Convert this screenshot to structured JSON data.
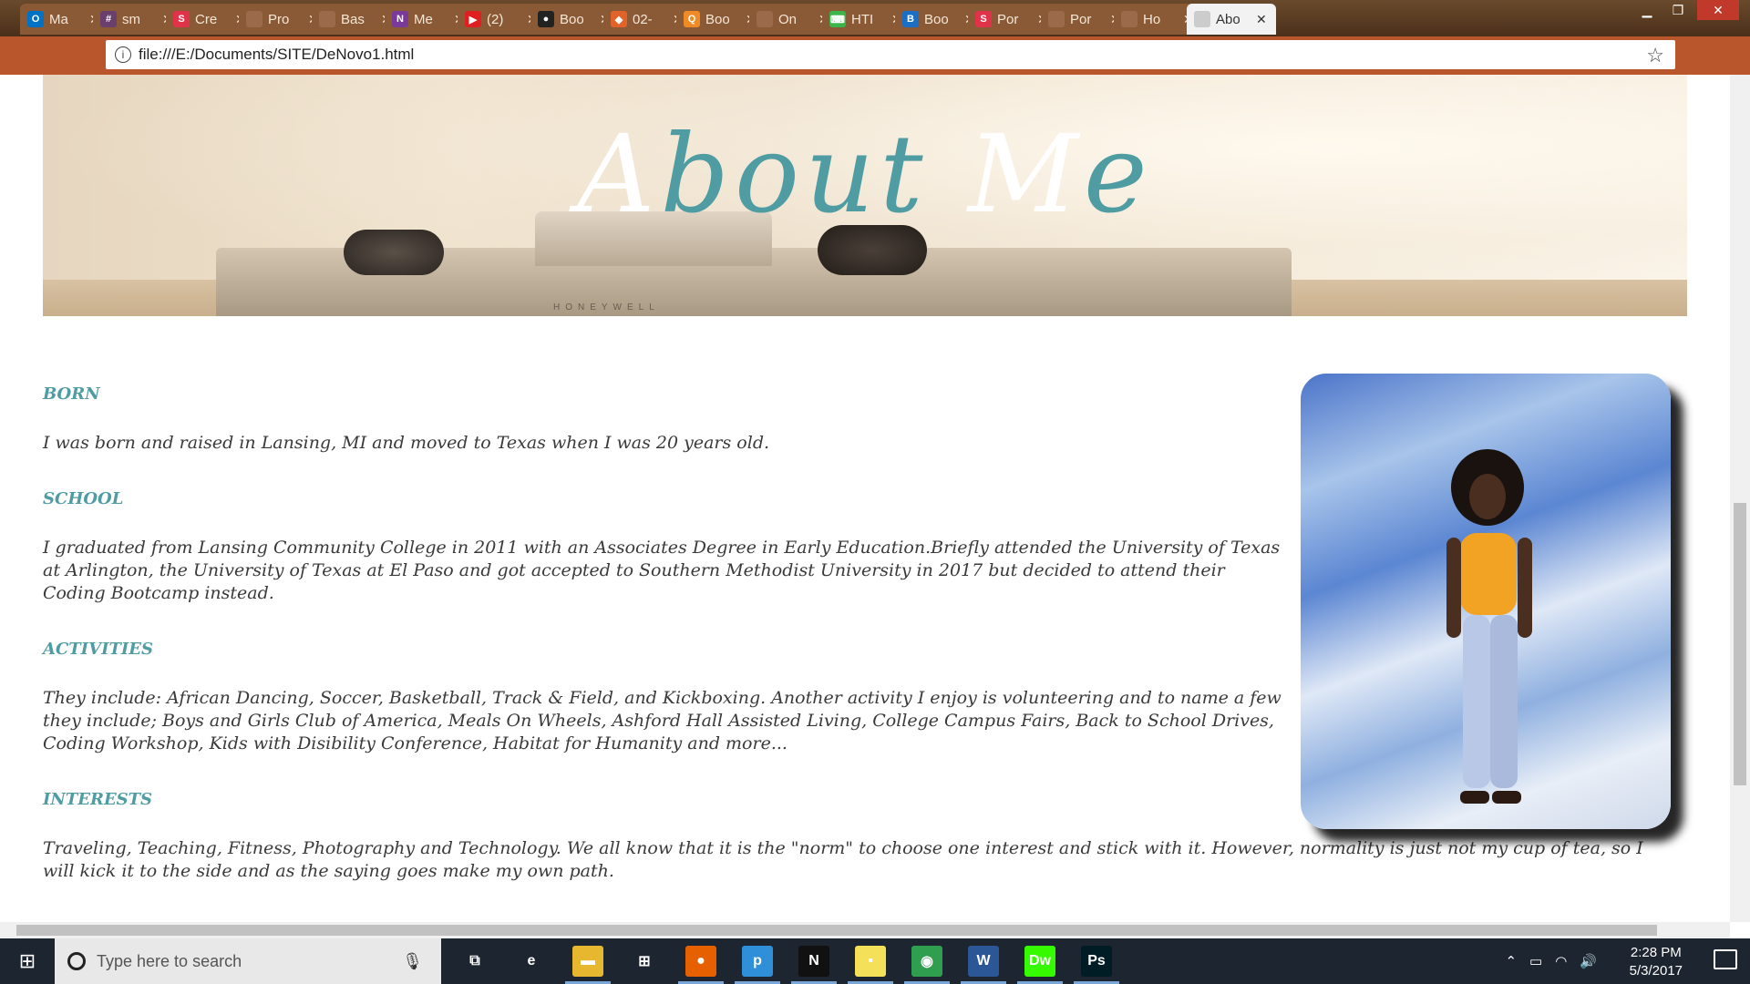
{
  "browser": {
    "tabs": [
      {
        "label": "Ma",
        "fav_text": "O",
        "fav_color": "#0072c6"
      },
      {
        "label": "sm",
        "fav_text": "#",
        "fav_color": "#6a3f6d"
      },
      {
        "label": "Cre",
        "fav_text": "S",
        "fav_color": "#e0334a"
      },
      {
        "label": "Pro",
        "fav_text": "",
        "fav_color": "#9a6a4a"
      },
      {
        "label": "Bas",
        "fav_text": "",
        "fav_color": "#9a6a4a"
      },
      {
        "label": "Me",
        "fav_text": "N",
        "fav_color": "#7a3a9a"
      },
      {
        "label": "(2)",
        "fav_text": "▶",
        "fav_color": "#e02020"
      },
      {
        "label": "Boo",
        "fav_text": "●",
        "fav_color": "#222222"
      },
      {
        "label": "02-",
        "fav_text": "◆",
        "fav_color": "#e2632a"
      },
      {
        "label": "Boo",
        "fav_text": "Q",
        "fav_color": "#f08a24"
      },
      {
        "label": "On",
        "fav_text": "",
        "fav_color": "#9a6a4a"
      },
      {
        "label": "HTI",
        "fav_text": "⌨",
        "fav_color": "#39b54a"
      },
      {
        "label": "Boo",
        "fav_text": "B",
        "fav_color": "#1a6fc4"
      },
      {
        "label": "Por",
        "fav_text": "S",
        "fav_color": "#e0334a"
      },
      {
        "label": "Por",
        "fav_text": "",
        "fav_color": "#9a6a4a"
      },
      {
        "label": "Ho",
        "fav_text": "",
        "fav_color": "#9a6a4a"
      },
      {
        "label": "Abo",
        "fav_text": "",
        "fav_color": "#cccccc"
      }
    ],
    "active_tab_index": 16,
    "url": "file:///E:/Documents/SITE/DeNovo1.html"
  },
  "page": {
    "hero_title_first": "A",
    "hero_title_accent": "bout",
    "hero_title_second": " M",
    "hero_title_accent2": "e",
    "camera_brand": "HONEYWELL",
    "sections": [
      {
        "heading": "BORN",
        "body": "I was born and raised in Lansing, MI and moved to Texas when I was 20 years old."
      },
      {
        "heading": "SCHOOL",
        "body": "I graduated from Lansing Community College in 2011 with an Associates Degree in Early Education.Briefly attended the University of Texas at Arlington, the University of Texas at El Paso and got accepted to Southern Methodist University in 2017 but decided to attend their Coding Bootcamp instead."
      },
      {
        "heading": "ACTIVITIES",
        "body": "They include: African Dancing, Soccer, Basketball, Track & Field, and Kickboxing. Another activity I enjoy is volunteering and to name a few they include; Boys and Girls Club of America, Meals On Wheels, Ashford Hall Assisted Living, College Campus Fairs, Back to School Drives, Coding Workshop, Kids with Disibility Conference, Habitat for Humanity and more..."
      },
      {
        "heading": "INTERESTS",
        "body": "Traveling, Teaching, Fitness, Photography and Technology. We all know that it is the \"norm\" to choose one interest and stick with it. However, normality is just not my cup of tea, so I will kick it to the side and as the saying goes make my own path."
      }
    ],
    "accent_color": "#4f9ca3"
  },
  "taskbar": {
    "search_placeholder": "Type here to search",
    "apps": [
      {
        "name": "task-view-icon",
        "label": "⧉",
        "color": "#1c2530"
      },
      {
        "name": "edge-icon",
        "label": "e",
        "color": "#1c2530"
      },
      {
        "name": "file-explorer-icon",
        "label": "▬",
        "color": "#e8b730"
      },
      {
        "name": "store-icon",
        "label": "⊞",
        "color": "#1c2530"
      },
      {
        "name": "firefox-icon",
        "label": "●",
        "color": "#e66000"
      },
      {
        "name": "pandora-icon",
        "label": "p",
        "color": "#2f8fd8"
      },
      {
        "name": "netflix-icon",
        "label": "N",
        "color": "#111111"
      },
      {
        "name": "sticky-notes-icon",
        "label": "▪",
        "color": "#f5e05a"
      },
      {
        "name": "chrome-icon",
        "label": "◉",
        "color": "#2f9e4f"
      },
      {
        "name": "word-icon",
        "label": "W",
        "color": "#2b5797"
      },
      {
        "name": "dreamweaver-icon",
        "label": "Dw",
        "color": "#35fa00"
      },
      {
        "name": "photoshop-icon",
        "label": "Ps",
        "color": "#001d26"
      }
    ],
    "time": "2:28 PM",
    "date": "5/3/2017"
  }
}
